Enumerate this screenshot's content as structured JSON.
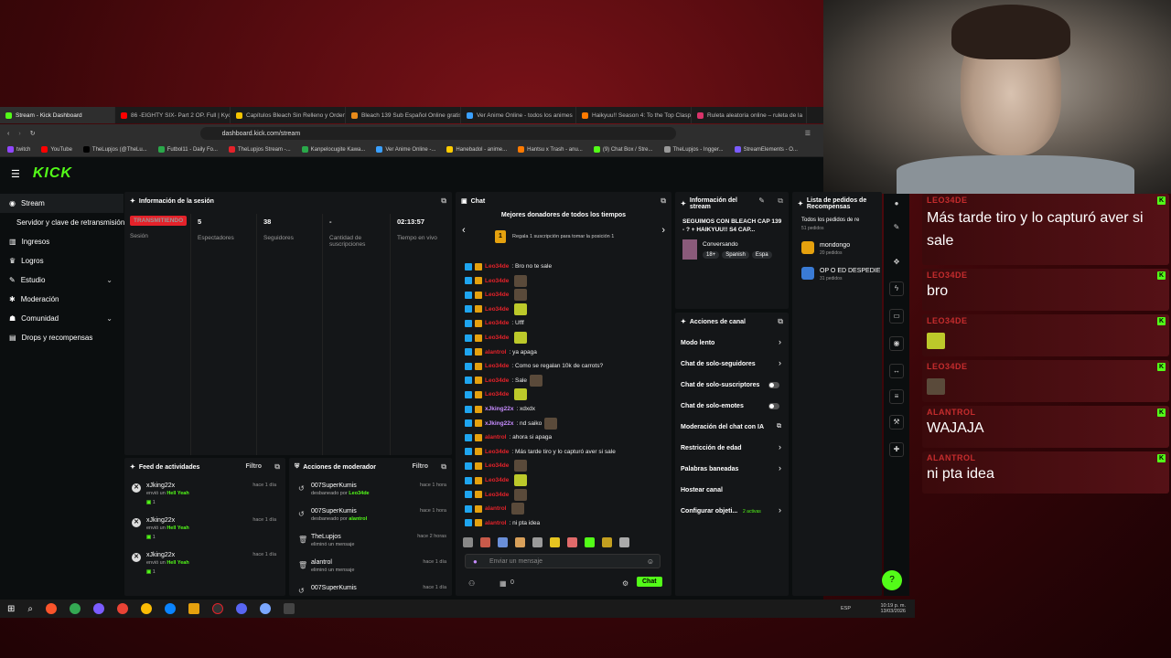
{
  "browser": {
    "tabs": [
      {
        "label": "Stream - Kick Dashboard",
        "color": "#53fc18",
        "active": true
      },
      {
        "label": "86 -EIGHTY SIX- Part 2 OP. Full | Kyo",
        "color": "#ff0000"
      },
      {
        "label": "Capítulos Bleach Sin Relleno y Orden",
        "color": "#f5c400"
      },
      {
        "label": "Bleach 139 Sub Español Online gratis",
        "color": "#e88a1a"
      },
      {
        "label": "Ver Anime Online - todos los animes",
        "color": "#3aa0ff"
      },
      {
        "label": "Haikyuu!! Season 4: To the Top Clasp",
        "color": "#ff7a00"
      },
      {
        "label": "Ruleta aleatoria online – ruleta de la",
        "color": "#d9336a"
      }
    ],
    "url": "dashboard.kick.com/stream",
    "bookmarks": [
      {
        "label": "twitch",
        "color": "#9146ff"
      },
      {
        "label": "YouTube",
        "color": "#ff0000"
      },
      {
        "label": "TheLupjos (@TheLu...",
        "color": "#000000"
      },
      {
        "label": "Futbol11 - Daily Fo...",
        "color": "#2aa84a"
      },
      {
        "label": "TheLupjos Stream -...",
        "color": "#e5222a"
      },
      {
        "label": "Kanpelocugite Kawa...",
        "color": "#2aa84a"
      },
      {
        "label": "Ver Anime Online -...",
        "color": "#3aa0ff"
      },
      {
        "label": "Hanebadol - anime...",
        "color": "#ffcc00"
      },
      {
        "label": "Hantsu x Trash - anu...",
        "color": "#ff7a00"
      },
      {
        "label": "(9) Chat Box / Stre...",
        "color": "#53fc18"
      },
      {
        "label": "TheLupjos - Ingger...",
        "color": "#999999"
      },
      {
        "label": "StreamElements - O...",
        "color": "#7b5cff"
      }
    ]
  },
  "sidebar": {
    "items": [
      {
        "label": "Stream",
        "icon": "video-icon",
        "selected": true
      },
      {
        "label": "Servidor y clave de retransmisión",
        "icon": "",
        "selected": false
      },
      {
        "label": "Ingresos",
        "icon": "chart-icon"
      },
      {
        "label": "Logros",
        "icon": "trophy-icon"
      },
      {
        "label": "Estudio",
        "icon": "brush-icon",
        "chevron": "⌄"
      },
      {
        "label": "Moderación",
        "icon": "wrench-icon"
      },
      {
        "label": "Comunidad",
        "icon": "community-icon",
        "chevron": "⌄"
      },
      {
        "label": "Drops y recompensas",
        "icon": "gift-icon"
      }
    ]
  },
  "session": {
    "title": "Información de la sesión",
    "status": "TRANSMITIENDO",
    "status_sub": "Sesión",
    "viewers": "5",
    "viewers_label": "Espectadores",
    "followers": "38",
    "followers_label": "Seguidores",
    "subs": "-",
    "subs_label": "Cantidad de suscripciones",
    "time": "02:13:57",
    "time_label": "Tiempo en vivo"
  },
  "feed": {
    "title": "Feed de actividades",
    "filter": "Filtro",
    "items": [
      {
        "name": "xJking22x",
        "sub": "envió un",
        "tag": "Hell Yeah",
        "count": "1",
        "time": "hace 1 día"
      },
      {
        "name": "xJking22x",
        "sub": "envió un",
        "tag": "Hell Yeah",
        "count": "1",
        "time": "hace 1 día"
      },
      {
        "name": "xJking22x",
        "sub": "envió un",
        "tag": "Hell Yeah",
        "count": "1",
        "time": "hace 1 día"
      }
    ]
  },
  "modactions": {
    "title": "Acciones de moderador",
    "filter": "Filtro",
    "items": [
      {
        "name": "007SuperKumis",
        "sub": "desbaneado por",
        "target": "Leo34de",
        "time": "hace 1 hora"
      },
      {
        "name": "007SuperKumis",
        "sub": "desbaneado por",
        "target": "alantrol",
        "time": "hace 1 hora"
      },
      {
        "name": "TheLupjos",
        "sub": "eliminó un mensaje",
        "target": "",
        "time": "hace 2 horas"
      },
      {
        "name": "alantrol",
        "sub": "eliminó un mensaje",
        "target": "",
        "time": "hace 1 día"
      },
      {
        "name": "007SuperKumis",
        "sub": "",
        "target": "",
        "time": "hace 1 día"
      }
    ]
  },
  "chat": {
    "title": "Chat",
    "donors_title": "Mejores donadores de todos los tiempos",
    "donors_rank": "1",
    "donors_text": "Regala 1 suscripción para tomar la posición 1",
    "lines": [
      {
        "name": "Leo34de",
        "text": ": Bro no te sale",
        "emote": "",
        "color": "red"
      },
      {
        "name": "Leo34de",
        "text": "",
        "emote": "emo2",
        "color": "red"
      },
      {
        "name": "Leo34de",
        "text": "",
        "emote": "emo2",
        "color": "red"
      },
      {
        "name": "Leo34de",
        "text": "",
        "emote": "emo",
        "color": "red"
      },
      {
        "name": "Leo34de",
        "text": ": Ufff",
        "emote": "",
        "color": "red"
      },
      {
        "name": "Leo34de",
        "text": "",
        "emote": "emo",
        "color": "red"
      },
      {
        "name": "alantrol",
        "text": ": ya apaga",
        "emote": "",
        "color": "red"
      },
      {
        "name": "Leo34de",
        "text": ": Como se regalan 10k de carrots?",
        "emote": "",
        "color": "red"
      },
      {
        "name": "Leo34de",
        "text": ": Sale",
        "emote": "emo2",
        "color": "red"
      },
      {
        "name": "Leo34de",
        "text": "",
        "emote": "emo",
        "color": "red"
      },
      {
        "name": "xJking22x",
        "text": ": xdxdx",
        "emote": "",
        "color": "pur"
      },
      {
        "name": "xJking22x",
        "text": ": nd saiko",
        "emote": "emo2",
        "color": "pur"
      },
      {
        "name": "alantrol",
        "text": ": ahora si apaga",
        "emote": "",
        "color": "red"
      },
      {
        "name": "Leo34de",
        "text": ": Más tarde tiro y lo capturó aver si sale",
        "emote": "",
        "color": "red"
      },
      {
        "name": "Leo34de",
        "text": "",
        "emote": "emo2",
        "color": "red"
      },
      {
        "name": "Leo34de",
        "text": "",
        "emote": "emo",
        "color": "red"
      },
      {
        "name": "Leo34de",
        "text": "",
        "emote": "emo2",
        "color": "red"
      },
      {
        "name": "alantrol",
        "text": "",
        "emote": "emo2",
        "color": "red"
      },
      {
        "name": "alantrol",
        "text": ": ni pta idea",
        "emote": "",
        "color": "red"
      }
    ],
    "placeholder": "Enviar un mensaje",
    "send": "Chat",
    "bottom_count": "0"
  },
  "streaminfo": {
    "title": "Información del stream",
    "stream_title": "SEGUIMOS CON BLEACH CAP 139 - ? + HAIKYUU!! S4 CAP...",
    "category": "Conversando",
    "tags": [
      "18+",
      "Spanish",
      "Espa"
    ]
  },
  "rewards": {
    "title": "Lista de pedidos de Recompensas",
    "subtitle": "Todos los pedidos de re",
    "subtitle2": "51 pedidos",
    "items": [
      {
        "name": "mondongo",
        "count": "20 pedidos",
        "color": "#e5a10e"
      },
      {
        "name": "OP O ED DESPEDIE",
        "count": "31 pedidos",
        "color": "#3a7bd5"
      }
    ]
  },
  "channelactions": {
    "title": "Acciones de canal",
    "items": [
      {
        "label": "Modo lento",
        "kind": "arrow"
      },
      {
        "label": "Chat de solo-seguidores",
        "kind": "arrow"
      },
      {
        "label": "Chat de solo-suscriptores",
        "kind": "toggle"
      },
      {
        "label": "Chat de solo-emotes",
        "kind": "toggle"
      },
      {
        "label": "Moderación del chat con IA",
        "kind": "ext"
      },
      {
        "label": "Restricción de edad",
        "kind": "arrow"
      },
      {
        "label": "Palabras baneadas",
        "kind": "arrow"
      },
      {
        "label": "Hostear canal",
        "kind": "none"
      },
      {
        "label": "Configurar objeti...",
        "kind": "arrow",
        "extra": "2 activas"
      }
    ]
  },
  "overlay": {
    "items": [
      {
        "name": "LEO34DE",
        "text": "Más tarde tiro y lo capturó aver si sale",
        "tall": true
      },
      {
        "name": "LEO34DE",
        "text": "bro"
      },
      {
        "name": "LEO34DE",
        "text": "",
        "emote": "emo"
      },
      {
        "name": "LEO34DE",
        "text": "",
        "emote": "emo2"
      },
      {
        "name": "ALANTROL",
        "text": "WAJAJA"
      },
      {
        "name": "ALANTROL",
        "text": "ni pta idea"
      }
    ]
  },
  "taskbar": {
    "time": "10:19 p. m.",
    "date": "13/03/2026",
    "lang": "ESP"
  },
  "colors": {
    "accent": "#53fc18",
    "live": "#e5222a"
  }
}
